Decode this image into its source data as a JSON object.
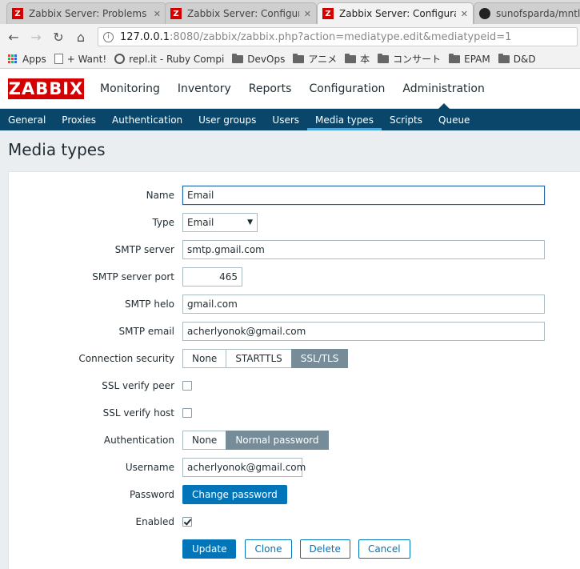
{
  "browser": {
    "tabs": [
      {
        "title": "Zabbix Server: Problems",
        "icon": "zabbix-favicon"
      },
      {
        "title": "Zabbix Server: Configuration",
        "icon": "zabbix-favicon"
      },
      {
        "title": "Zabbix Server: Configuration",
        "icon": "zabbix-favicon",
        "active": true
      },
      {
        "title": "sunofsparda/mntla",
        "icon": "github-icon"
      }
    ],
    "url_host": "127.0.0.1",
    "url_rest": ":8080/zabbix/zabbix.php?action=mediatype.edit&mediatypeid=1",
    "bookmarks": [
      "Apps",
      "+ Want!",
      "repl.it - Ruby Compi",
      "DevOps",
      "アニメ",
      "本",
      "コンサート",
      "EPAM",
      "D&D"
    ]
  },
  "header": {
    "logo": "ZABBIX",
    "menu": [
      "Monitoring",
      "Inventory",
      "Reports",
      "Configuration",
      "Administration"
    ],
    "selected_menu": "Administration"
  },
  "submenu": [
    "General",
    "Proxies",
    "Authentication",
    "User groups",
    "Users",
    "Media types",
    "Scripts",
    "Queue"
  ],
  "page": {
    "title": "Media types"
  },
  "form": {
    "name_label": "Name",
    "name_value": "Email",
    "type_label": "Type",
    "type_value": "Email",
    "smtp_server_label": "SMTP server",
    "smtp_server_value": "smtp.gmail.com",
    "smtp_port_label": "SMTP server port",
    "smtp_port_value": "465",
    "smtp_helo_label": "SMTP helo",
    "smtp_helo_value": "gmail.com",
    "smtp_email_label": "SMTP email",
    "smtp_email_value": "acherlyonok@gmail.com",
    "connection_security_label": "Connection security",
    "connection_security_options": [
      "None",
      "STARTTLS",
      "SSL/TLS"
    ],
    "connection_security_selected": "SSL/TLS",
    "ssl_verify_peer_label": "SSL verify peer",
    "ssl_verify_peer_checked": false,
    "ssl_verify_host_label": "SSL verify host",
    "ssl_verify_host_checked": false,
    "authentication_label": "Authentication",
    "authentication_options": [
      "None",
      "Normal password"
    ],
    "authentication_selected": "Normal password",
    "username_label": "Username",
    "username_value": "acherlyonok@gmail.com",
    "password_label": "Password",
    "change_password_button": "Change password",
    "enabled_label": "Enabled",
    "enabled_checked": true
  },
  "actions": {
    "update": "Update",
    "clone": "Clone",
    "delete": "Delete",
    "cancel": "Cancel"
  },
  "colors": {
    "brand_red": "#d40000",
    "nav_blue": "#0a466a",
    "primary_blue": "#0275b8",
    "segment_on": "#768d99"
  }
}
